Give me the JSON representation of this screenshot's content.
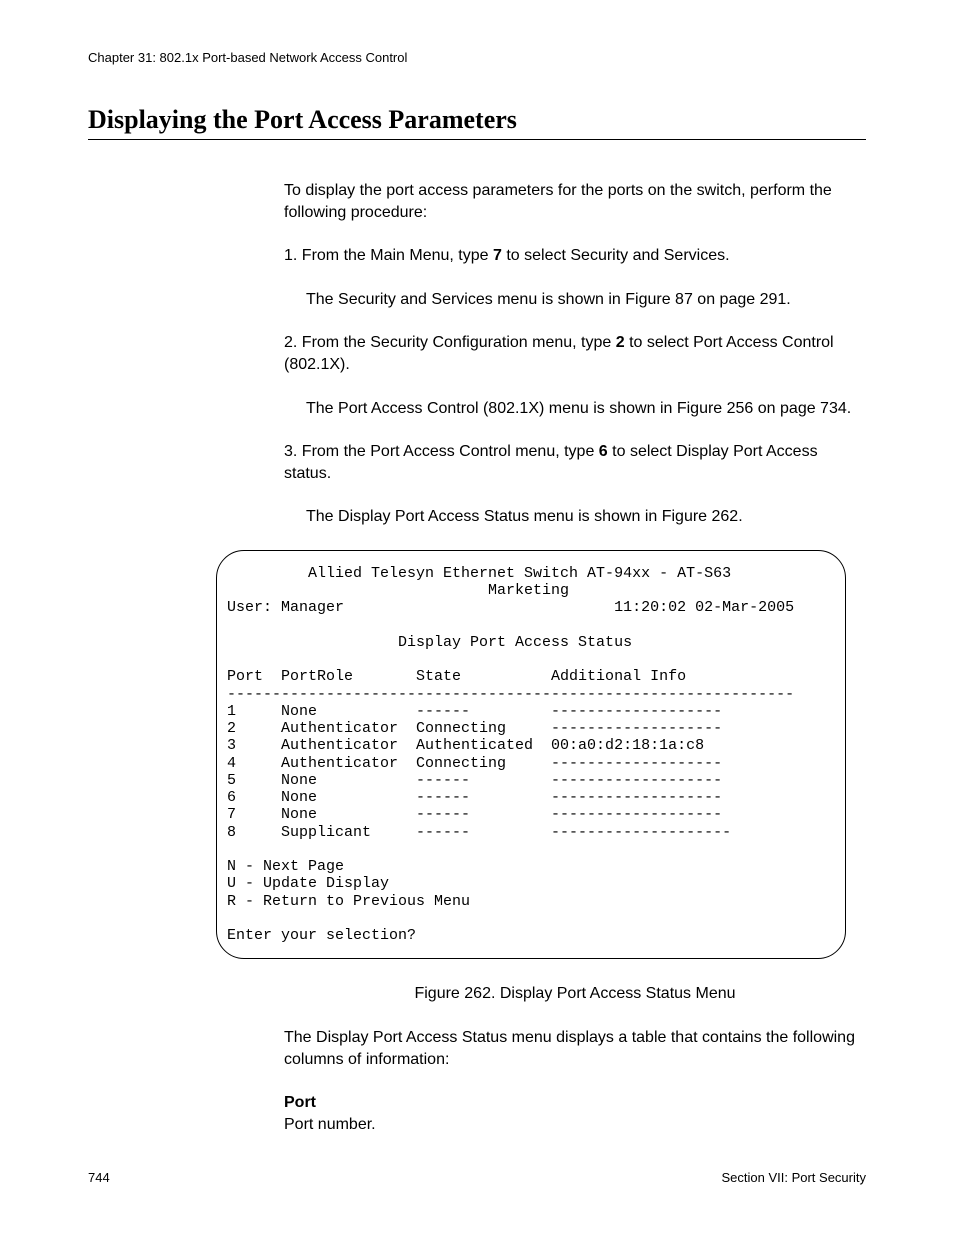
{
  "header": {
    "chapter": "Chapter 31: 802.1x Port-based Network Access Control"
  },
  "title": "Displaying the Port Access Parameters",
  "intro": "To display the port access parameters for the ports on the switch, perform the following procedure:",
  "steps": {
    "s1_pre": "1.  From the Main Menu, type ",
    "s1_bold": "7",
    "s1_post": " to select Security and Services.",
    "s1_note": "The Security and Services menu is shown in Figure 87 on page 291.",
    "s2_pre": "2.  From the Security Configuration menu, type ",
    "s2_bold": "2",
    "s2_post": " to select Port Access Control (802.1X).",
    "s2_note": "The Port Access Control (802.1X) menu is shown in Figure 256 on page 734.",
    "s3_pre": "3.  From the Port Access Control menu, type ",
    "s3_bold": "6",
    "s3_post": " to select Display Port Access status.",
    "s3_note": "The Display Port Access Status menu is shown in Figure 262."
  },
  "terminal": {
    "line1": "         Allied Telesyn Ethernet Switch AT-94xx - AT-S63",
    "line2": "                             Marketing",
    "line3": "User: Manager                              11:20:02 02-Mar-2005",
    "line4": "                   Display Port Access Status",
    "blank": "",
    "col_header": "Port  PortRole       State          Additional Info",
    "divider": "---------------------------------------------------------------",
    "rows": [
      "1     None           ------         -------------------",
      "2     Authenticator  Connecting     -------------------",
      "3     Authenticator  Authenticated  00:a0:d2:18:1a:c8",
      "4     Authenticator  Connecting     -------------------",
      "5     None           ------         -------------------",
      "6     None           ------         -------------------",
      "7     None           ------         -------------------",
      "8     Supplicant     ------         --------------------"
    ],
    "nav1": "N - Next Page",
    "nav2": "U - Update Display",
    "nav3": "R - Return to Previous Menu",
    "prompt": "Enter your selection?"
  },
  "figure_caption": "Figure 262. Display Port Access Status Menu",
  "after_figure": "The Display Port Access Status menu displays a table that contains the following columns of information:",
  "def_term": "Port",
  "def_desc": "Port number.",
  "footer": {
    "page": "744",
    "section": "Section VII: Port Security"
  }
}
